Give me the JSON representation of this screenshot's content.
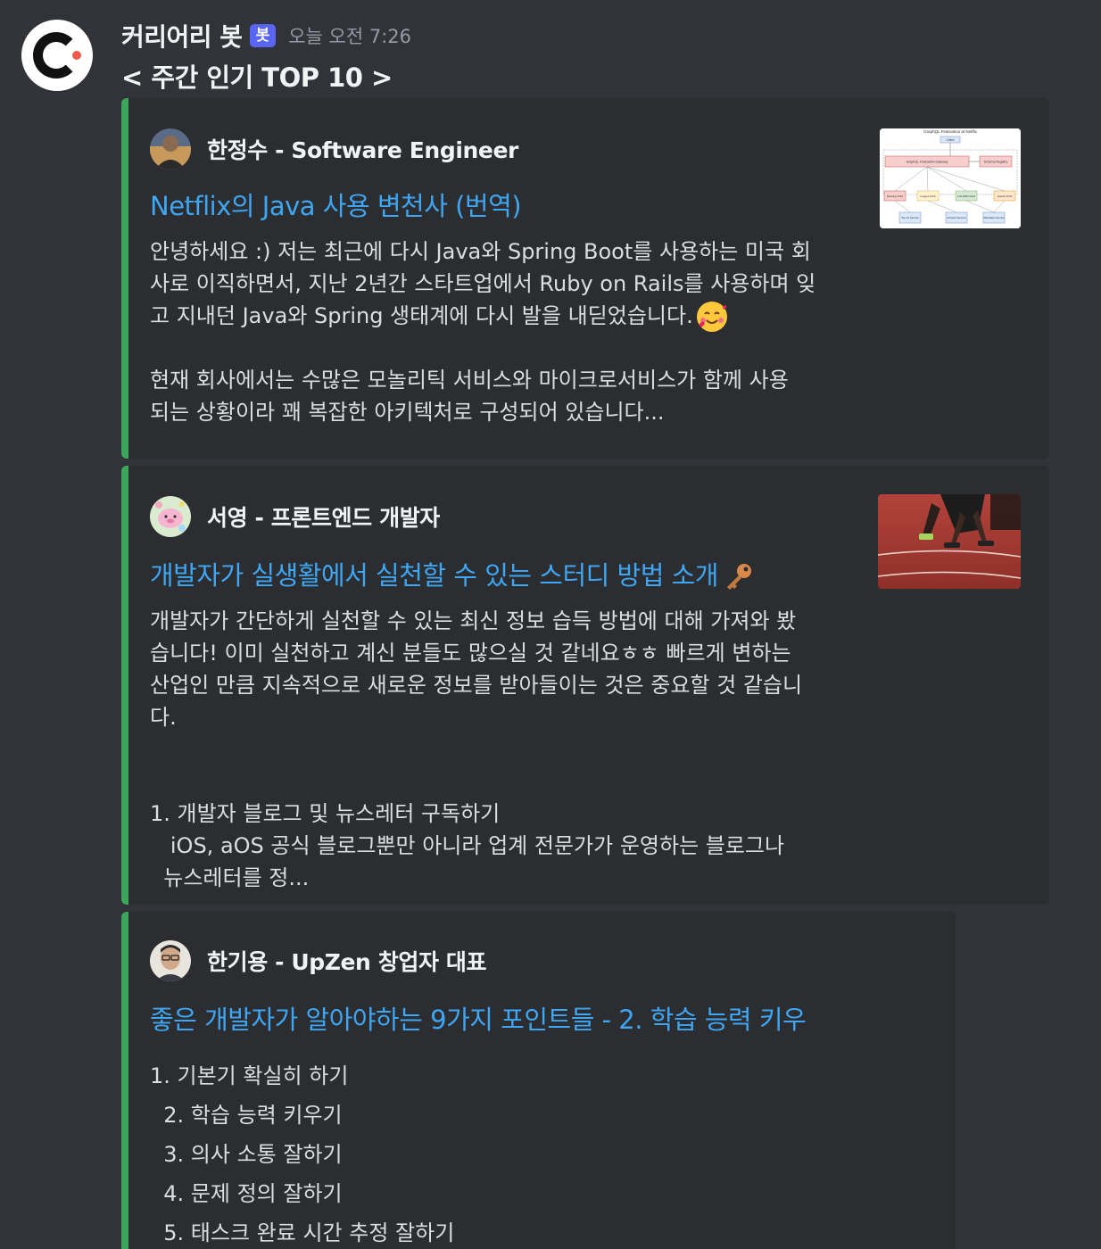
{
  "message": {
    "username": "커리어리 봇",
    "bot_tag": "봇",
    "timestamp": "오늘 오전 7:26",
    "title": "< 주간 인기 TOP 10 >"
  },
  "embeds": [
    {
      "author": "한정수 - Software Engineer",
      "title": "Netflix의 Java 사용 변천사 (번역)",
      "description": "안녕하세요 :) 저는 최근에 다시 Java와 Spring Boot를 사용하는 미국 회\n사로 이직하면서, 지난 2년간 스타트업에서 Ruby on Rails를 사용하며 잊\n고 지내던 Java와 Spring 생태계에 다시 발을 내딛었습니다.",
      "description_2": "\n\n현재 회사에서는 수많은 모놀리틱 서비스와 마이크로서비스가 함께 사용\n되는 상황이라 꽤 복잡한 아키텍처로 구성되어 있습니다...",
      "emoji": "smiling-face-with-hearts-icon",
      "thumbnail": {
        "title": "GraphQL Federation at Netflix",
        "client": "Client",
        "gateway": "GraphQL Federation Gateway",
        "registry": "Schema Registry",
        "services": [
          "Ranking DGS",
          "Images DGS",
          "LOLOMO DGS",
          "Search DGS"
        ],
        "backends": [
          "Top 10 Service",
          "Artwork Service",
          "Metadata Service"
        ]
      }
    },
    {
      "author": "서영 - 프론트엔드 개발자",
      "title": "개발자가 실생활에서 실천할 수 있는 스터디 방법 소개",
      "title_icon": "key-icon",
      "description": "개발자가 간단하게 실천할 수 있는 최신 정보 습득 방법에 대해 가져와 봤\n습니다! 이미 실천하고 계신 분들도 많으실 것 같네요ㅎㅎ 빠르게 변하는\n산업인 만큼 지속적으로 새로운 정보를 받아들이는 것은 중요할 것 같습니\n다.\n\n\n1. 개발자 블로그 및 뉴스레터 구독하기\n   iOS, aOS 공식 블로그뿐만 아니라 업계 전문가가 운영하는 블로그나\n  뉴스레터를 정...",
      "thumbnail": "runner-on-track-photo"
    },
    {
      "author": "한기용 - UpZen 창업자 대표",
      "title": "좋은 개발자가 알아야하는 9가지 포인트들 - 2. 학습 능력 키우",
      "description": "1. 기본기 확실히 하기\n  2. 학습 능력 키우기\n  3. 의사 소통 잘하기\n  4. 문제 정의 잘하기\n  5. 태스크 완료 시간 추정 잘하기"
    }
  ],
  "colors": {
    "background": "#313338",
    "embed_background": "#2b2d31",
    "embed_accent": "#3ba55c",
    "link": "#3ea6f2",
    "bot_tag": "#5865f2"
  }
}
